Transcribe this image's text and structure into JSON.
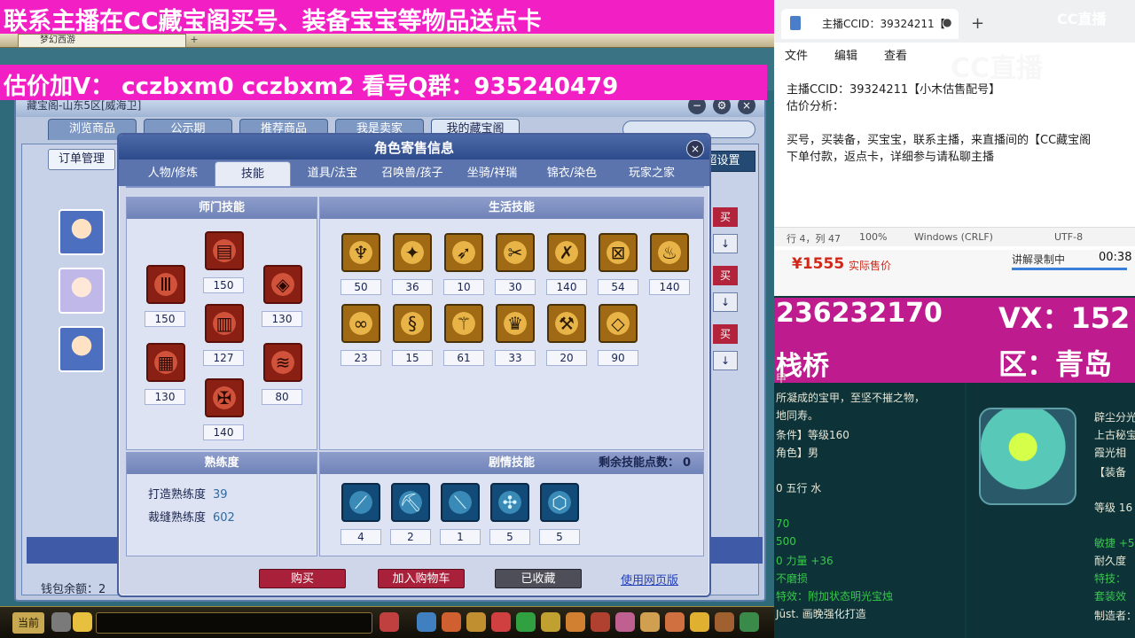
{
  "banner": {
    "line1": "联系主播在CC藏宝阁买号、装备宝宝等物品送点卡",
    "line2": "估价加V： cczbxm0   cczbxm2   看号Q群：935240479"
  },
  "game": {
    "tab_label": "梦幻西游",
    "store_title": "藏宝阁-山东5区[威海卫]",
    "store_tabs": [
      "浏览商品",
      "公示期",
      "推荐商品",
      "我是卖家",
      "我的藏宝阁"
    ],
    "order_button": "订单管理",
    "settings_button": "超设置",
    "buy_mini": "买",
    "sort_mini": "↓",
    "wallet_label": "钱包余额：2",
    "current_button": "当前"
  },
  "dialog": {
    "title": "角色寄售信息",
    "close": "×",
    "tabs": [
      "人物/修炼",
      "技能",
      "道具/法宝",
      "召唤兽/孩子",
      "坐骑/祥瑞",
      "锦衣/染色",
      "玩家之家"
    ],
    "active_tab": "技能",
    "school_skills": {
      "title": "师门技能",
      "levels": [
        "150",
        "150",
        "130",
        "127",
        "130",
        "80",
        "140"
      ]
    },
    "life_skills": {
      "title": "生活技能",
      "levels": [
        "50",
        "36",
        "10",
        "30",
        "140",
        "54",
        "140",
        "23",
        "15",
        "61",
        "33",
        "20",
        "90"
      ]
    },
    "proficiency": {
      "title": "熟练度",
      "rows": [
        {
          "label": "打造熟练度",
          "value": "39"
        },
        {
          "label": "裁缝熟练度",
          "value": "602"
        }
      ]
    },
    "story_skills": {
      "title": "剧情技能",
      "remaining_label": "剩余技能点数：",
      "remaining_value": "0",
      "levels": [
        "4",
        "2",
        "1",
        "5",
        "5"
      ]
    },
    "buttons": {
      "buy": "购买",
      "add_cart": "加入购物车",
      "favorited": "已收藏",
      "web": "使用网页版"
    }
  },
  "notepad": {
    "tab_title": "主播CCID：39324211【",
    "menu": [
      "文件",
      "编辑",
      "查看"
    ],
    "lines": [
      "主播CCID：39324211【小木估售配号】",
      "估价分析：",
      "",
      "买号，买装备，买宝宝，联系主播，来直播间的【CC藏宝阁",
      "下单付款，返点卡，详细参与请私聊主播"
    ],
    "status": [
      "行 4，列 47",
      "100%",
      "Windows (CRLF)",
      "UTF-8"
    ],
    "logo": "CC直播",
    "logo_large": "CC直播"
  },
  "stream": {
    "price": "¥1555",
    "price_label": "实际售价",
    "rec_label": "讲解录制中",
    "rec_time": "00:38",
    "phone": "236232170",
    "vx": "VX：152",
    "bridge": "栈桥",
    "region": "区：青岛",
    "item_left": [
      "甲",
      "所凝成的宝甲，至坚不摧之物，",
      "地同寿。",
      "条件】等级160",
      "角色】男",
      "0 五行 水",
      "70",
      "500",
      "0 力量 +36",
      "不磨损",
      "特效：附加状态明光宝烛",
      "Jūst. 画晚强化打造"
    ],
    "item_right": [
      "辟尘分光",
      "上古秘宝",
      "霞光相",
      "【装备",
      "等级 16",
      "敏捷 +5",
      "耐久度",
      "特技：",
      "套装效",
      "制造者："
    ]
  },
  "colors": {
    "banner": "#f21fc4",
    "accent_red": "#a9203a",
    "dialog_head": "#2d4a8a"
  }
}
